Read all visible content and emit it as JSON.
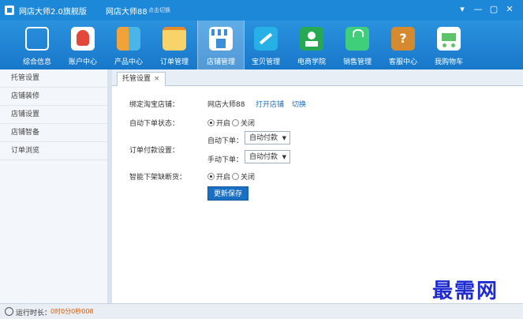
{
  "window": {
    "app_title": "网店大师2.0旗舰版",
    "shop_name": "网店大师88",
    "switch_label": "点击切换"
  },
  "toolbar": [
    {
      "label": "综合信息",
      "icon": "monitor-icon",
      "color": "#ffffff"
    },
    {
      "label": "账户中心",
      "icon": "user-avatar-icon",
      "color": "#e2473a"
    },
    {
      "label": "产品中心",
      "icon": "product-grid-icon",
      "color": "#f1a33a"
    },
    {
      "label": "订单管理",
      "icon": "order-notebook-icon",
      "color": "#f7d36a"
    },
    {
      "label": "店铺管理",
      "icon": "storefront-icon",
      "color": "#3b8fd9",
      "active": true
    },
    {
      "label": "宝贝管理",
      "icon": "wrench-tools-icon",
      "color": "#27b0e6"
    },
    {
      "label": "电商学院",
      "icon": "academy-icon",
      "color": "#27a852"
    },
    {
      "label": "销售管理",
      "icon": "shopping-bag-icon",
      "color": "#3fcf7b"
    },
    {
      "label": "客服中心",
      "icon": "help-book-icon",
      "color": "#d68a2f"
    },
    {
      "label": "我购物车",
      "icon": "shopping-cart-icon",
      "color": "#5bc46b"
    }
  ],
  "sidebar": {
    "items": [
      "托管设置",
      "店铺装修",
      "店铺设置",
      "店铺智备",
      "订单浏览"
    ]
  },
  "tab": {
    "label": "托管设置",
    "close": "×"
  },
  "form": {
    "bind_shop_label": "绑定淘宝店铺：",
    "bind_shop_value": "网店大师88",
    "open_shop_link": "打开店铺",
    "switch_link": "切换",
    "auto_order_label": "自动下单状态：",
    "auto_order_on": "开启",
    "auto_order_off": "关闭",
    "payment_label": "订单付款设置：",
    "auto_order_sub_label": "自动下单：",
    "auto_order_select": "自动付款",
    "manual_order_sub_label": "手动下单：",
    "manual_order_select": "自动付款",
    "smart_label": "智能下架缺断货：",
    "smart_on": "开启",
    "smart_off": "关闭",
    "save_button": "更新保存"
  },
  "status": {
    "runtime_label": "运行时长：",
    "runtime_value": "0时0分0秒008"
  },
  "watermark": "最需网"
}
